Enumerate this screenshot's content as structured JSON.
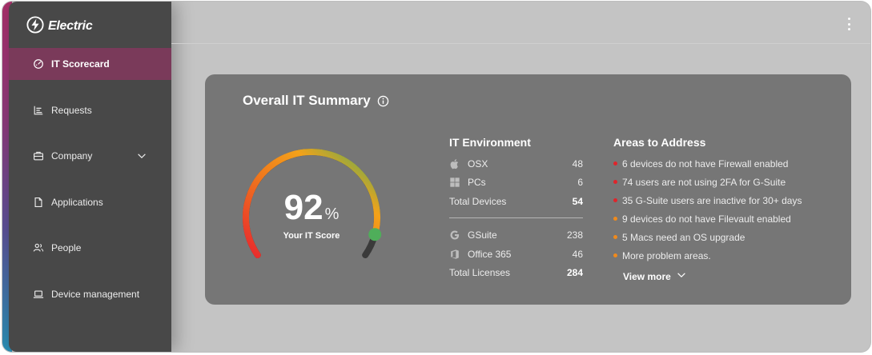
{
  "brand": {
    "name": "Electric",
    "icon": "lightning-bolt-icon"
  },
  "sidebar": {
    "items": [
      {
        "label": "IT Scorecard",
        "icon": "gauge-icon",
        "active": true
      },
      {
        "label": "Requests",
        "icon": "list-icon"
      },
      {
        "label": "Company",
        "icon": "briefcase-icon",
        "has_chevron": true
      },
      {
        "label": "Applications",
        "icon": "document-icon"
      },
      {
        "label": "People",
        "icon": "people-icon"
      },
      {
        "label": "Device management",
        "icon": "laptop-icon"
      }
    ]
  },
  "header": {
    "menu_icon": "kebab-menu-icon"
  },
  "summary": {
    "title": "Overall IT Summary",
    "info_icon": "info-icon",
    "score": {
      "value": "92",
      "unit": "%",
      "label": "Your IT Score",
      "fraction": 0.92
    },
    "environment": {
      "title": "IT Environment",
      "devices": [
        {
          "label": "OSX",
          "value": "48",
          "icon": "apple-icon"
        },
        {
          "label": "PCs",
          "value": "6",
          "icon": "windows-icon"
        }
      ],
      "total_devices": {
        "label": "Total Devices",
        "value": "54"
      },
      "licenses": [
        {
          "label": "GSuite",
          "value": "238",
          "icon": "google-icon"
        },
        {
          "label": "Office 365",
          "value": "46",
          "icon": "office-icon"
        }
      ],
      "total_licenses": {
        "label": "Total Licenses",
        "value": "284"
      }
    },
    "areas": {
      "title": "Areas to Address",
      "items": [
        {
          "text": "6 devices do not have Firewall enabled",
          "severity": "high"
        },
        {
          "text": "74 users are not using 2FA for G-Suite",
          "severity": "high"
        },
        {
          "text": "35 G-Suite users are inactive for 30+ days",
          "severity": "high"
        },
        {
          "text": "9 devices do not have Filevault enabled",
          "severity": "medium"
        },
        {
          "text": "5 Macs need an OS upgrade",
          "severity": "medium"
        },
        {
          "text": "More problem areas.",
          "severity": "medium"
        }
      ],
      "view_more": "View more"
    }
  },
  "colors": {
    "high": "#e0242b",
    "medium": "#f08a1c",
    "active_nav": "#7a3a5a",
    "sidebar": "#484848",
    "card": "#767676"
  }
}
